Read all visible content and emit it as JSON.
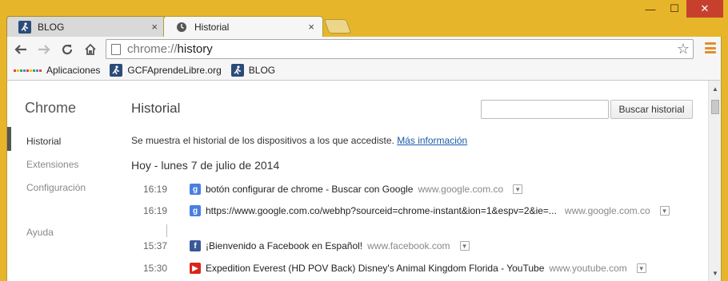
{
  "window": {
    "minimize": "—",
    "maximize": "☐",
    "close": "✕"
  },
  "tabs": [
    {
      "label": "BLOG",
      "close": "×"
    },
    {
      "label": "Historial",
      "close": "×"
    }
  ],
  "address": {
    "scheme": "chrome://",
    "host": "history"
  },
  "bookmarks": [
    {
      "label": "Aplicaciones",
      "icon": "apps-icon"
    },
    {
      "label": "GCFAprendeLibre.org",
      "icon": "runner-icon"
    },
    {
      "label": "BLOG",
      "icon": "runner-icon"
    }
  ],
  "sidebar": {
    "brand": "Chrome",
    "items": [
      {
        "label": "Historial"
      },
      {
        "label": "Extensiones"
      },
      {
        "label": "Configuración"
      },
      {
        "label": "Ayuda"
      }
    ]
  },
  "main": {
    "title": "Historial",
    "search_button": "Buscar historial",
    "info_text": "Se muestra el historial de los dispositivos a los que accediste.",
    "info_link": "Más información",
    "day_header": "Hoy - lunes 7 de julio de 2014"
  },
  "entries": [
    {
      "time": "16:19",
      "icon": "google-icon",
      "title": "botón configurar de chrome - Buscar con Google",
      "domain": "www.google.com.co"
    },
    {
      "time": "16:19",
      "icon": "google-icon",
      "title": "https://www.google.com.co/webhp?sourceid=chrome-instant&ion=1&espv=2&ie=...",
      "domain": "www.google.com.co"
    },
    {
      "time": "15:37",
      "icon": "facebook-icon",
      "title": "¡Bienvenido a Facebook en Español!",
      "domain": "www.facebook.com"
    },
    {
      "time": "15:30",
      "icon": "youtube-icon",
      "title": "Expedition Everest (HD POV Back) Disney's Animal Kingdom Florida - YouTube",
      "domain": "www.youtube.com"
    }
  ],
  "colors": {
    "frame": "#e7b529",
    "close": "#c7402e",
    "link": "#1a5aa8",
    "menu": "#e38e2c"
  }
}
